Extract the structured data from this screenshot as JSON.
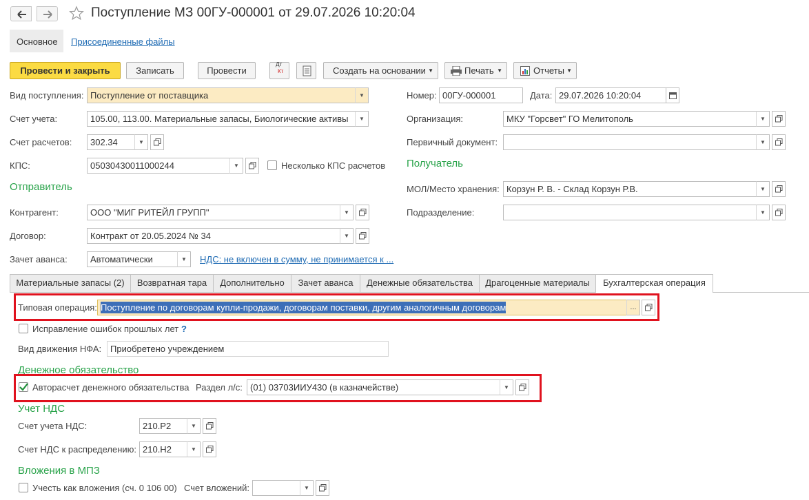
{
  "header": {
    "title": "Поступление МЗ 00ГУ-000001 от 29.07.2026 10:20:04"
  },
  "nav": {
    "main_tab": "Основное",
    "files_link": "Присоединенные файлы"
  },
  "toolbar": {
    "post_close": "Провести и закрыть",
    "save": "Записать",
    "post": "Провести",
    "dtkt_top": "Дт",
    "dtkt_bottom": "Кт",
    "create_based": "Создать на основании",
    "print": "Печать",
    "reports": "Отчеты"
  },
  "left": {
    "receipt_type": {
      "label": "Вид поступления:",
      "value": "Поступление от поставщика"
    },
    "account": {
      "label": "Счет учета:",
      "value": "105.00, 113.00. Материальные запасы, Биологические активы"
    },
    "settlement": {
      "label": "Счет расчетов:",
      "value": "302.34"
    },
    "kps": {
      "label": "КПС:",
      "value": "05030430011000244"
    },
    "multi_kps": "Несколько КПС расчетов",
    "sender_section": "Отправитель",
    "counterparty": {
      "label": "Контрагент:",
      "value": "ООО \"МИГ РИТЕЙЛ ГРУПП\""
    },
    "contract": {
      "label": "Договор:",
      "value": "Контракт от 20.05.2024 № 34"
    },
    "advance": {
      "label": "Зачет аванса:",
      "value": "Автоматически"
    },
    "vat_link": "НДС: не включен в сумму, не принимается к ..."
  },
  "right": {
    "number": {
      "label": "Номер:",
      "value": "00ГУ-000001"
    },
    "date": {
      "label": "Дата:",
      "value": "29.07.2026 10:20:04"
    },
    "organization": {
      "label": "Организация:",
      "value": "МКУ \"Горсвет\" ГО Мелитополь"
    },
    "primary_doc": {
      "label": "Первичный документ:",
      "value": ""
    },
    "recipient_section": "Получатель",
    "mol": {
      "label": "МОЛ/Место хранения:",
      "value": "Корзун Р. В. - Склад Корзун Р.В."
    },
    "department": {
      "label": "Подразделение:",
      "value": ""
    }
  },
  "tabs": [
    "Материальные запасы (2)",
    "Возвратная тара",
    "Дополнительно",
    "Зачет аванса",
    "Денежные обязательства",
    "Драгоценные материалы",
    "Бухгалтерская операция"
  ],
  "operation": {
    "typical_label": "Типовая операция:",
    "typical_value": "Поступление по договорам купли-продажи, договорам поставки, другим аналогичным договорам",
    "fix_errors": "Исправление ошибок прошлых лет",
    "help": "?",
    "nfa_label": "Вид движения НФА:",
    "nfa_value": "Приобретено учреждением",
    "money_section": "Денежное обязательство",
    "auto_calc": "Авторасчет денежного обязательства",
    "auto_calc_checked": true,
    "section_label": "Раздел л/с:",
    "section_value": "(01) 03703ИИУ430 (в казначействе)",
    "vat_section": "Учет НДС",
    "vat_account_label": "Счет учета НДС:",
    "vat_account_value": "210.Р2",
    "vat_distr_label": "Счет НДС к распределению:",
    "vat_distr_value": "210.Н2",
    "invest_section": "Вложения в МПЗ",
    "invest_check": "Учесть как вложения (сч. 0 106 00)",
    "invest_account_label": "Счет вложений:",
    "invest_account_value": ""
  },
  "colors": {
    "accent_green": "#29a34a",
    "primary_button": "#fbdb43",
    "highlight_red": "#e0121e",
    "field_yellow": "#fcebc3",
    "selection_blue": "#3d6fb8"
  }
}
